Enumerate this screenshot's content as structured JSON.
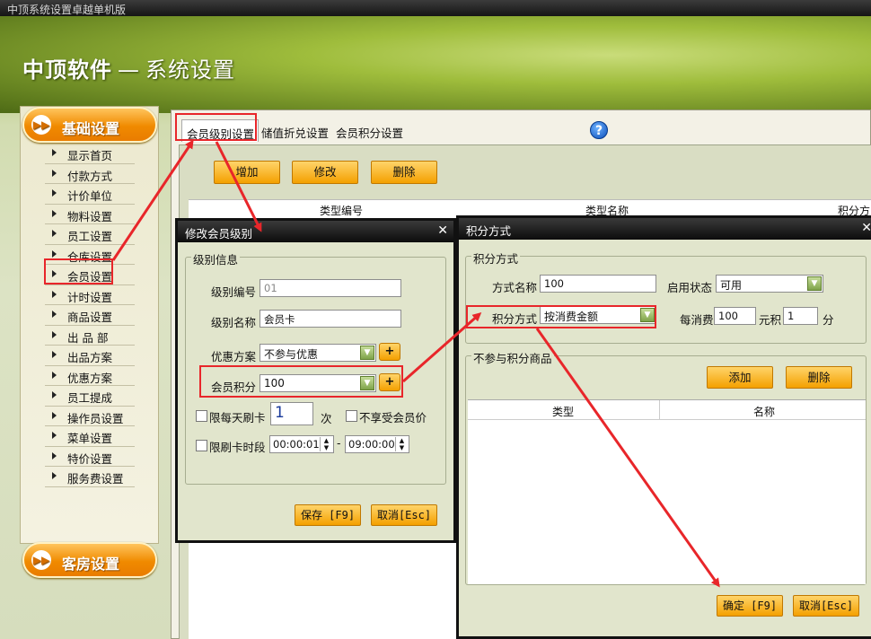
{
  "window": {
    "title": "中顶系统设置卓越单机版"
  },
  "header": {
    "brand": "中顶软件",
    "dash": "—",
    "title": "系统设置"
  },
  "sidebar": {
    "category_basic": "基础设置",
    "category_room": "客房设置",
    "items": [
      "显示首页",
      "付款方式",
      "计价单位",
      "物料设置",
      "员工设置",
      "仓库设置",
      "会员设置",
      "计时设置",
      "商品设置",
      "出 品 部",
      "出品方案",
      "优惠方案",
      "员工提成",
      "操作员设置",
      "菜单设置",
      "特价设置",
      "服务费设置"
    ]
  },
  "tabs": [
    "会员级别设置",
    "储值折兑设置",
    "会员积分设置"
  ],
  "toolbar": {
    "add": "增加",
    "edit": "修改",
    "delete": "删除"
  },
  "grid": {
    "columns": [
      "类型编号",
      "类型名称",
      "积分方"
    ]
  },
  "dialog_level": {
    "title": "修改会员级别",
    "group": "级别信息",
    "code_label": "级别编号",
    "code_value": "01",
    "name_label": "级别名称",
    "name_value": "会员卡",
    "discount_label": "优惠方案",
    "discount_value": "不参与优惠",
    "points_label": "会员积分",
    "points_value": "100",
    "limit_daily_label": "限每天刷卡",
    "limit_daily_value": "1",
    "times_unit": "次",
    "no_member_price_label": "不享受会员价",
    "limit_time_label": "限刷卡时段",
    "time_from": "00:00:01",
    "time_sep": "-",
    "time_to": "09:00:00",
    "save": "保存 [F9]",
    "cancel": "取消[Esc]"
  },
  "dialog_points": {
    "title": "积分方式",
    "group": "积分方式",
    "name_label": "方式名称",
    "name_value": "100",
    "status_label": "启用状态",
    "status_value": "可用",
    "method_label": "积分方式",
    "method_value": "按消费金额",
    "per_spend_label": "每消费",
    "per_spend_value": "100",
    "yuan_label": "元积",
    "points_value": "1",
    "points_unit": "分",
    "excluded_group": "不参与积分商品",
    "add": "添加",
    "delete": "删除",
    "columns": [
      "类型",
      "名称"
    ],
    "ok": "确定 [F9]",
    "cancel": "取消[Esc]"
  },
  "colors": {
    "accent_orange": "#f4a000",
    "annotation_red": "#e8262a",
    "header_green": "#9fbd3c"
  }
}
